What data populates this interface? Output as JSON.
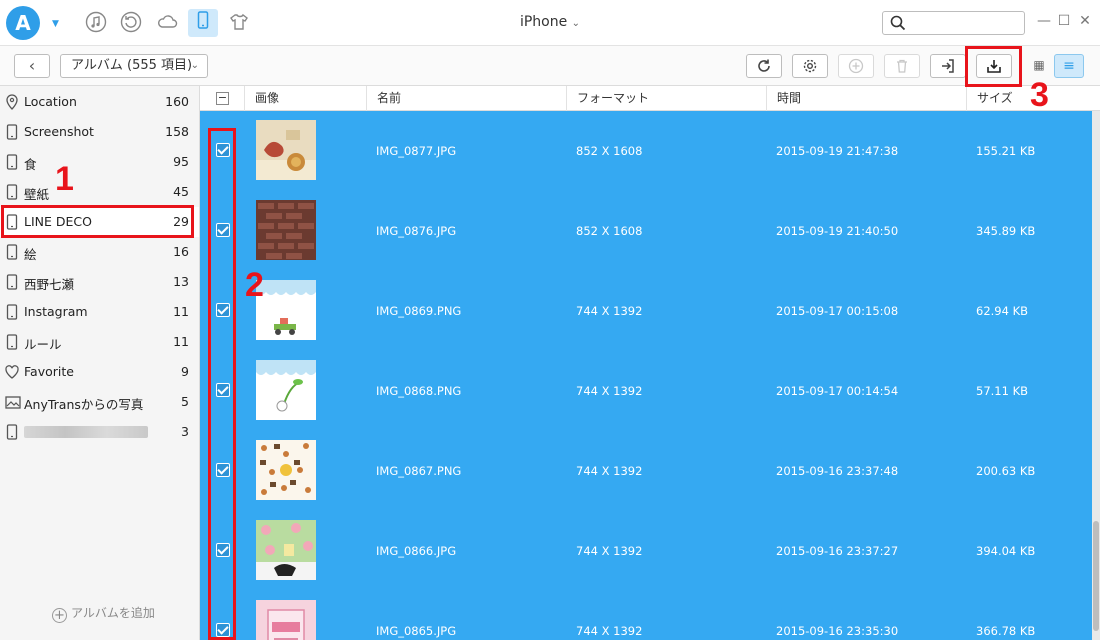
{
  "titlebar": {
    "device_name": "iPhone",
    "search": {
      "value": "",
      "placeholder": ""
    },
    "nav_icons": [
      "music-icon",
      "history-icon",
      "cloud-icon",
      "phone-icon",
      "shirt-icon"
    ]
  },
  "toolbar": {
    "album_selector": "アルバム (555 項目)",
    "buttons": [
      "refresh-icon",
      "settings-icon",
      "add-icon",
      "delete-icon",
      "import-icon",
      "export-to-pc-icon",
      "grid-view-icon",
      "list-view-icon"
    ]
  },
  "sidebar": {
    "items": [
      {
        "label": "Location",
        "count": "160",
        "icon": "location-pin-icon"
      },
      {
        "label": "Screenshot",
        "count": "158",
        "icon": "phone-icon"
      },
      {
        "label": "食",
        "count": "95",
        "icon": "phone-icon"
      },
      {
        "label": "壁紙",
        "count": "45",
        "icon": "phone-icon"
      },
      {
        "label": "LINE DECO",
        "count": "29",
        "icon": "phone-icon"
      },
      {
        "label": "絵",
        "count": "16",
        "icon": "phone-icon"
      },
      {
        "label": "西野七瀬",
        "count": "13",
        "icon": "phone-icon"
      },
      {
        "label": "Instagram",
        "count": "11",
        "icon": "phone-icon"
      },
      {
        "label": "ルール",
        "count": "11",
        "icon": "phone-icon"
      },
      {
        "label": "Favorite",
        "count": "9",
        "icon": "heart-icon"
      },
      {
        "label": "AnyTransからの写真",
        "count": "5",
        "icon": "photo-icon"
      },
      {
        "label": "",
        "count": "3",
        "icon": "phone-icon"
      }
    ],
    "add_album": "アルバムを追加"
  },
  "table": {
    "columns": [
      "画像",
      "名前",
      "フォーマット",
      "時間",
      "サイズ"
    ],
    "rows": [
      {
        "name": "IMG_0877.JPG",
        "format": "852 X 1608",
        "time": "2015-09-19 21:47:38",
        "size": "155.21 KB"
      },
      {
        "name": "IMG_0876.JPG",
        "format": "852 X 1608",
        "time": "2015-09-19 21:40:50",
        "size": "345.89 KB"
      },
      {
        "name": "IMG_0869.PNG",
        "format": "744 X 1392",
        "time": "2015-09-17 00:15:08",
        "size": "62.94 KB"
      },
      {
        "name": "IMG_0868.PNG",
        "format": "744 X 1392",
        "time": "2015-09-17 00:14:54",
        "size": "57.11 KB"
      },
      {
        "name": "IMG_0867.PNG",
        "format": "744 X 1392",
        "time": "2015-09-16 23:37:48",
        "size": "200.63 KB"
      },
      {
        "name": "IMG_0866.JPG",
        "format": "744 X 1392",
        "time": "2015-09-16 23:37:27",
        "size": "394.04 KB"
      },
      {
        "name": "IMG_0865.JPG",
        "format": "744 X 1392",
        "time": "2015-09-16 23:35:30",
        "size": "366.78 KB"
      }
    ]
  },
  "annotations": {
    "step1": "1",
    "step2": "2",
    "step3": "3"
  },
  "colors": {
    "selection": "#35a9f2",
    "accent": "#2f9ee8",
    "annotation": "#e8141b"
  }
}
